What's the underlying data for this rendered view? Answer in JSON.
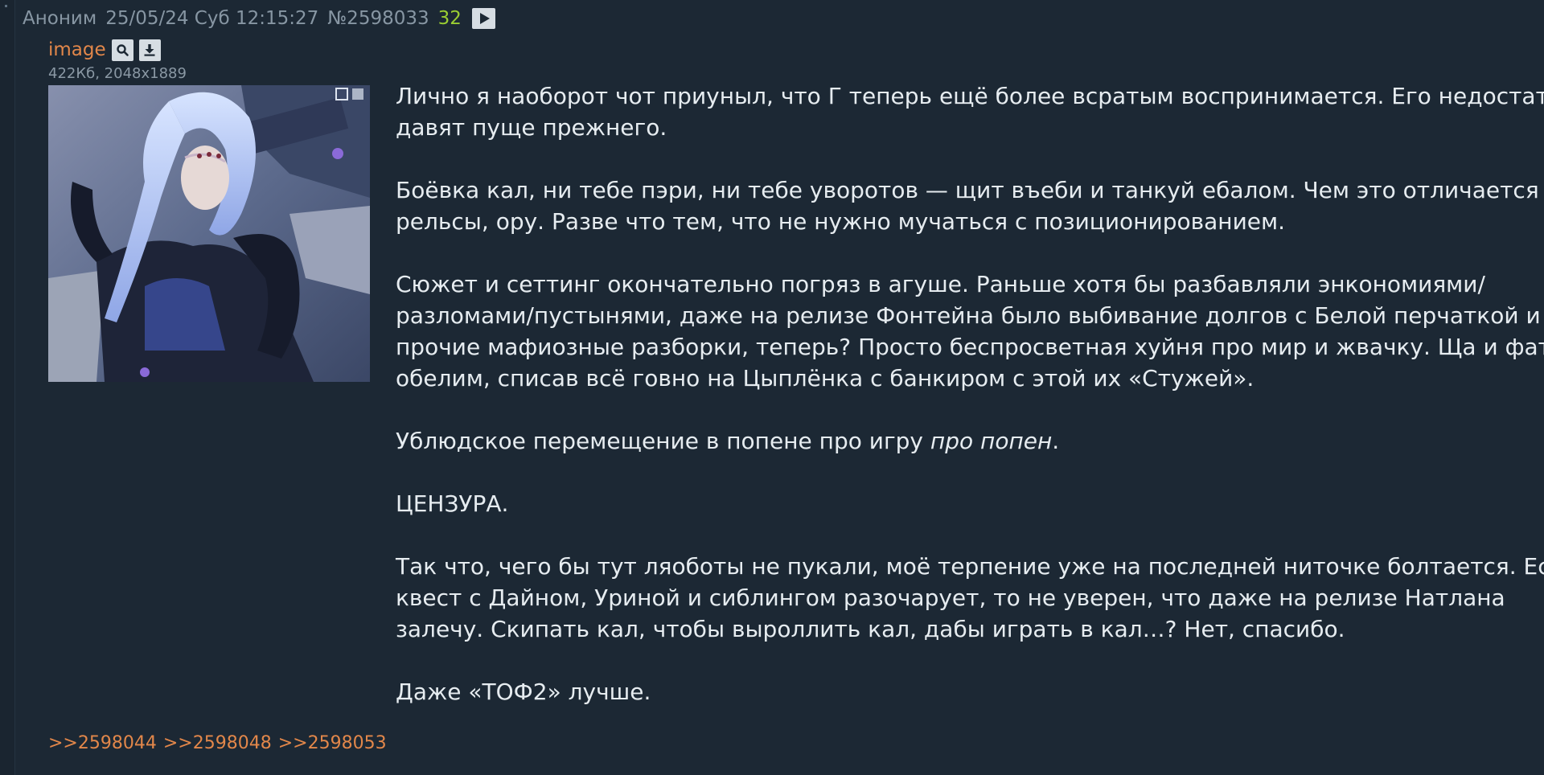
{
  "header": {
    "author": "Аноним",
    "date": "25/05/24 Суб 12:15:27",
    "post_number": "№2598033",
    "index": "32"
  },
  "file": {
    "name": "image",
    "meta": "422Кб, 2048x1889"
  },
  "body": {
    "p1": [
      "Лично я наоборот чот приуныл, что Г теперь ещё более всратым воспринимается. Его недостатки",
      "давят пуще прежнего."
    ],
    "p2": [
      "Боёвка кал, ни тебе пэри, ни тебе уворотов — щит въеби и танкуй ебалом. Чем это отличается от",
      "рельсы, ору. Разве что тем, что не нужно мучаться с позиционированием."
    ],
    "p3": [
      "Сюжет и сеттинг окончательно погряз в агуше. Раньше хотя бы разбавляли энкономиями/",
      "разломами/пустынями, даже на релизе Фонтейна было выбивание долгов с Белой перчаткой и",
      "прочие мафиозные разборки, теперь? Просто беспросветная хуйня про мир и жвачку. Ща и фатуев",
      "обелим, списав всё говно на Цыплёнка с банкиром с этой их «Стужей»."
    ],
    "p4_text": "Ублюдское перемещение в попене про игру ",
    "p4_em": "про попен",
    "p4_end": ".",
    "p5": "ЦЕНЗУРА.",
    "p6": [
      "Так что, чего бы тут ляоботы не пукали, моё терпение уже на последней ниточке болтается. Если",
      "квест с Дайном, Уриной и сиблингом разочарует, то не уверен, что даже на релизе Натлана",
      "залечу. Скипать кал, чтобы выроллить кал, дабы играть в кал…? Нет, спасибо."
    ],
    "p7": "Даже «ТОФ2» лучше."
  },
  "replies": [
    ">>2598044",
    ">>2598048",
    ">>2598053"
  ],
  "colors": {
    "background": "#17212b",
    "post_bg": "#1c2834",
    "link_orange": "#e2874a",
    "count_green": "#9acd32",
    "text": "#e6ecf0"
  },
  "icons": {
    "play": "play-icon",
    "search": "search-icon",
    "download": "download-icon"
  }
}
